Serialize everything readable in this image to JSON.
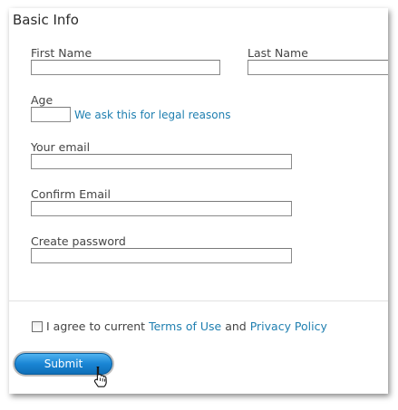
{
  "section": {
    "title": "Basic Info"
  },
  "fields": {
    "first_name": {
      "label": "First Name",
      "value": ""
    },
    "last_name": {
      "label": "Last Name",
      "value": ""
    },
    "age": {
      "label": "Age",
      "value": "",
      "hint": "We ask this for legal reasons"
    },
    "email": {
      "label": "Your email",
      "value": ""
    },
    "confirm_email": {
      "label": "Confirm Email",
      "value": ""
    },
    "password": {
      "label": "Create password",
      "value": ""
    }
  },
  "agreement": {
    "checked": false,
    "prefix": "I agree to current ",
    "terms_link": "Terms of Use",
    "joiner": " and ",
    "privacy_link": "Privacy Policy"
  },
  "submit": {
    "label": "Submit"
  },
  "colors": {
    "link": "#1f7fb0",
    "button": "#1a85d4"
  },
  "icons": {
    "cursor": "hand-pointer-icon"
  }
}
